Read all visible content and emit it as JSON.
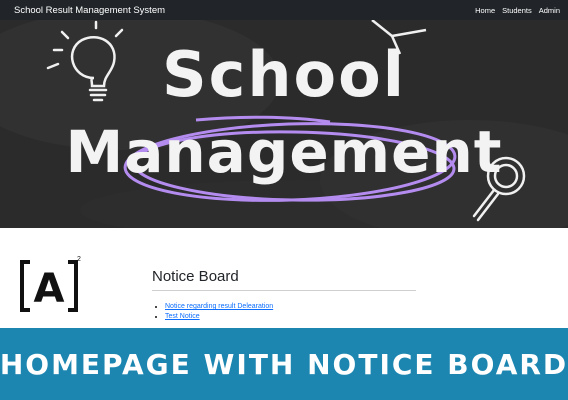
{
  "navbar": {
    "brand": "School Result Management System",
    "links": [
      "Home",
      "Students",
      "Admin"
    ]
  },
  "hero": {
    "line1": "School",
    "line2": "Management"
  },
  "logo": {
    "text": "A",
    "superscript": "2"
  },
  "notice_board": {
    "heading": "Notice Board",
    "items": [
      "Notice regarding result Delearation",
      "Test Notice"
    ]
  },
  "banner": {
    "text": "HOMEPAGE WITH NOTICE BOARD"
  },
  "colors": {
    "navbar_bg": "#212529",
    "hero_bg": "#2d2d2d",
    "accent_purple": "#b48cf0",
    "link_blue": "#0d6efd",
    "banner_bg": "#1c86b1"
  },
  "icons": [
    "lightbulb-icon",
    "magnifier-icon",
    "book-icon"
  ]
}
